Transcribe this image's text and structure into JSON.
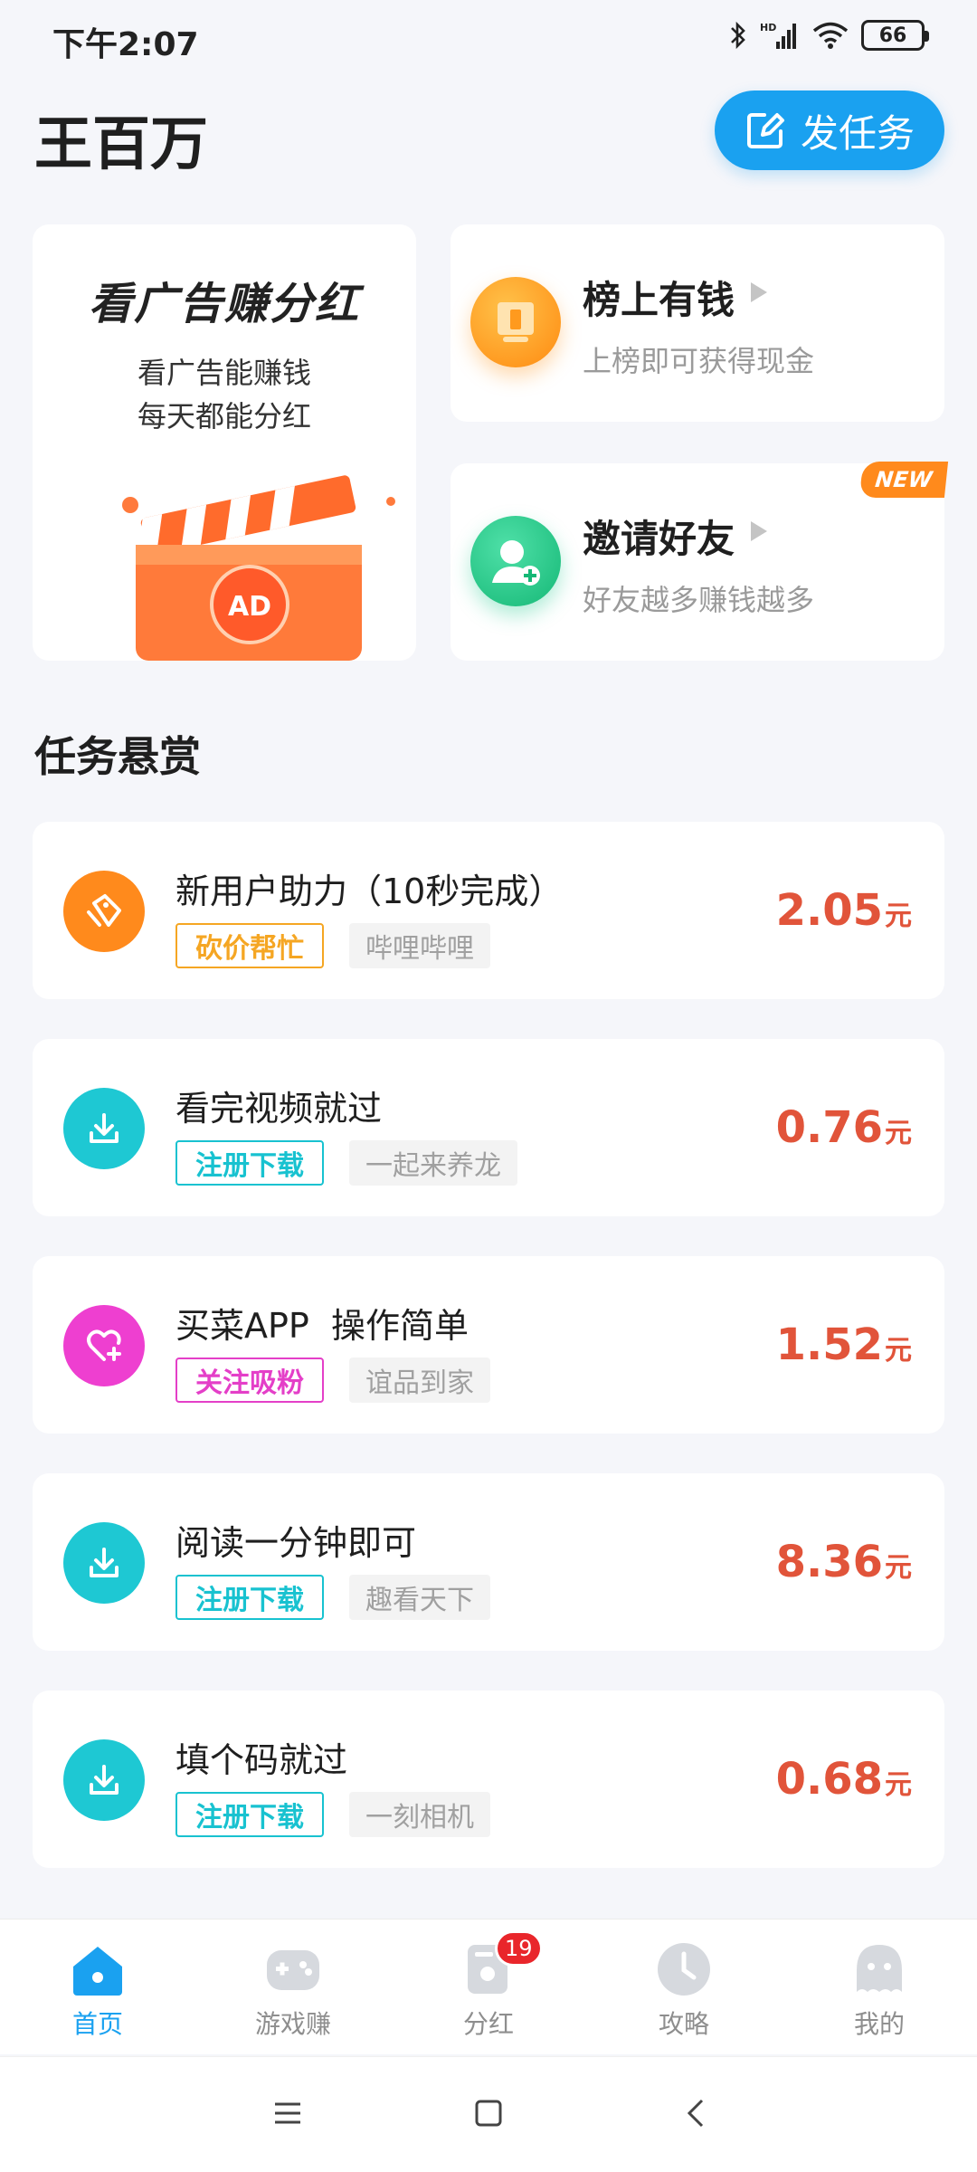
{
  "status_bar": {
    "time": "下午2:07",
    "battery": "66",
    "icons": [
      "bluetooth-icon",
      "signal-icon",
      "wifi-icon",
      "battery-icon"
    ]
  },
  "header": {
    "title": "王百万",
    "post_button_label": "发任务"
  },
  "ad_card": {
    "title": "看广告赚分红",
    "subtitle_line1": "看广告能赚钱",
    "subtitle_line2": "每天都能分红",
    "illustration_text": "AD"
  },
  "promo_cards": [
    {
      "title": "榜上有钱",
      "description": "上榜即可获得现金",
      "icon": "trophy-icon",
      "color": "#ff9a1e"
    },
    {
      "title": "邀请好友",
      "description": "好友越多赚钱越多",
      "icon": "add-user-icon",
      "color": "#1fc98a",
      "badge": "NEW"
    }
  ],
  "section_title": "任务悬赏",
  "tasks": [
    {
      "title": "新用户助力（10秒完成）",
      "tag": "砍价帮忙",
      "source": "哔哩哔哩",
      "price": "2.05",
      "unit": "元",
      "icon": "tag-icon",
      "tag_color": "#f5a623",
      "icon_color": "#ff8a1c"
    },
    {
      "title": "看完视频就过",
      "tag": "注册下载",
      "source": "一起来养龙",
      "price": "0.76",
      "unit": "元",
      "icon": "download-icon",
      "tag_color": "#18c2d0",
      "icon_color": "#1ec8d3"
    },
    {
      "title": "买菜APP  操作简单",
      "tag": "关注吸粉",
      "source": "谊品到家",
      "price": "1.52",
      "unit": "元",
      "icon": "heart-plus-icon",
      "tag_color": "#e43fc8",
      "icon_color": "#ee3fd0"
    },
    {
      "title": "阅读一分钟即可",
      "tag": "注册下载",
      "source": "趣看天下",
      "price": "8.36",
      "unit": "元",
      "icon": "download-icon",
      "tag_color": "#18c2d0",
      "icon_color": "#1ec8d3"
    },
    {
      "title": "填个码就过",
      "tag": "注册下载",
      "source": "一刻相机",
      "price": "0.68",
      "unit": "元",
      "icon": "download-icon",
      "tag_color": "#18c2d0",
      "icon_color": "#1ec8d3"
    }
  ],
  "bottom_nav": [
    {
      "label": "首页",
      "icon": "home-icon",
      "active": true
    },
    {
      "label": "游戏赚",
      "icon": "gamepad-icon"
    },
    {
      "label": "分红",
      "icon": "dividend-icon",
      "badge": "19"
    },
    {
      "label": "攻略",
      "icon": "clock-icon"
    },
    {
      "label": "我的",
      "icon": "profile-icon"
    }
  ],
  "colors": {
    "accent": "#1aa1f0",
    "price": "#e1543a",
    "background": "#f5f6fa",
    "badge": "#e9262b"
  }
}
